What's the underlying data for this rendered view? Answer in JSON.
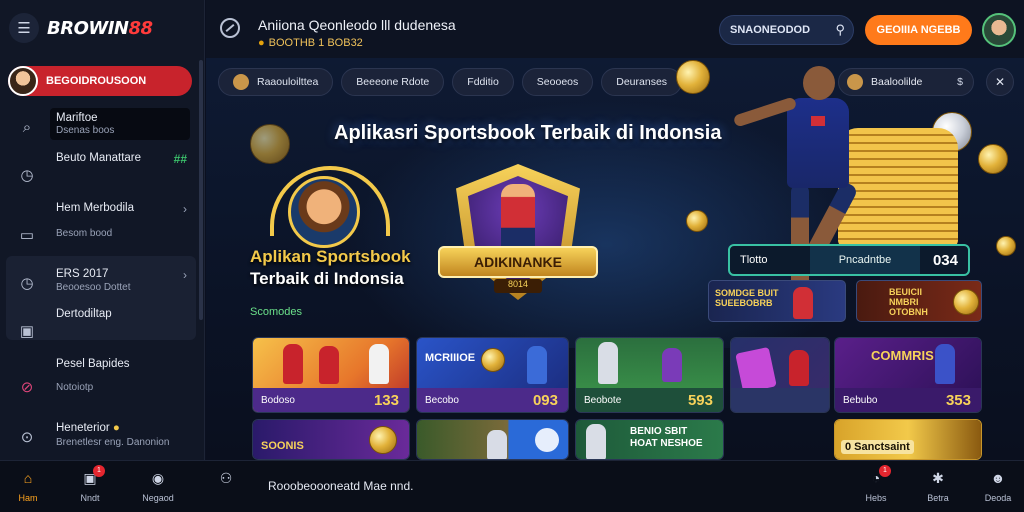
{
  "app": {
    "logo_text": "BROWIN",
    "logo_num": "88"
  },
  "sidebar": {
    "user_label": "BEGOIDROUSOON",
    "items": [
      {
        "icon": "search-icon",
        "title": "Mariftoe",
        "sub": "Dsenas boos"
      },
      {
        "icon": "clock-icon",
        "title": "Beuto Manattare",
        "sub": "",
        "badge": "##"
      },
      {
        "icon": "chart-icon",
        "title": "Hem Merbodila",
        "sub": "Besom bood"
      },
      {
        "icon": "clock-icon",
        "title": "ERS 2017",
        "sub": "Beooesoo Dottet"
      },
      {
        "icon": "screen-icon",
        "title": "Dertodiltap",
        "sub": ""
      },
      {
        "icon": "target-icon",
        "title": "Pesel Bapides",
        "sub": "Notoiotp"
      },
      {
        "icon": "camera-icon",
        "title": "Heneterior",
        "sub": "Brenetlesr eng. Danonion"
      }
    ]
  },
  "topbar": {
    "title": "Aniiona Qeonleodo lll dudenesa",
    "subtitle": "BOOTHB 1 BOB32",
    "search_label": "SNAONEODOD",
    "cta_label": "GEOIIIA NGEBB"
  },
  "chips": [
    "Raaouloilttea",
    "Beeeone Rdote",
    "Fdditio",
    "Seooeos",
    "Deuranses"
  ],
  "right_chip": "Baaloolilde",
  "hero": {
    "title": "Aplikasri Sportsbook Terbaik di Indonsia",
    "sub_title_1": "Aplikan Sportsbook",
    "sub_title_2": "Terbaik di Indonsia",
    "tag": "Scomodes",
    "badge_text": "ADIKINANKE",
    "badge_sub": "8014",
    "stat_left": "Tlotto",
    "stat_mid": "Pncadntbe",
    "stat_right": "034"
  },
  "promos": [
    {
      "text": "SOMDGE BUIT\nSUEEBOBRB"
    },
    {
      "text": "BEUICII\nNMBRI\nOTOBNH"
    }
  ],
  "cards": [
    {
      "name": "Bodoso",
      "value": "133"
    },
    {
      "name": "Becobo",
      "value": "093",
      "title": "MCRIIIOE"
    },
    {
      "name": "Beobote",
      "value": "593"
    },
    {
      "name": "",
      "value": ""
    },
    {
      "name": "Bebubo",
      "value": "353",
      "title": "COMMRIS"
    },
    {
      "name": "",
      "value": "",
      "title": "SOONIS"
    },
    {
      "name": "",
      "value": ""
    },
    {
      "name": "",
      "value": "",
      "title": "BENIO SBIT\nHOAT NESHOE"
    },
    {
      "name": "",
      "value": "",
      "title": "0 Sanctsaint"
    }
  ],
  "bottomnav": {
    "items": [
      {
        "icon": "home-icon",
        "label": "Ham"
      },
      {
        "icon": "gift-icon",
        "label": "Nndt",
        "badge": "1"
      },
      {
        "icon": "shield-icon",
        "label": "Negaod"
      },
      {
        "icon": "user-icon",
        "label": ""
      },
      {
        "icon": "headset-icon",
        "label": "Hebs",
        "badge": "1"
      },
      {
        "icon": "star-icon",
        "label": "Betra"
      },
      {
        "icon": "profile-icon",
        "label": "Deoda"
      }
    ],
    "status_text": "Rooobeoooneatd Mae nnd."
  },
  "colors": {
    "accent": "#ff7a1a",
    "brand_red": "#c8232c",
    "gold": "#f7d25a"
  }
}
